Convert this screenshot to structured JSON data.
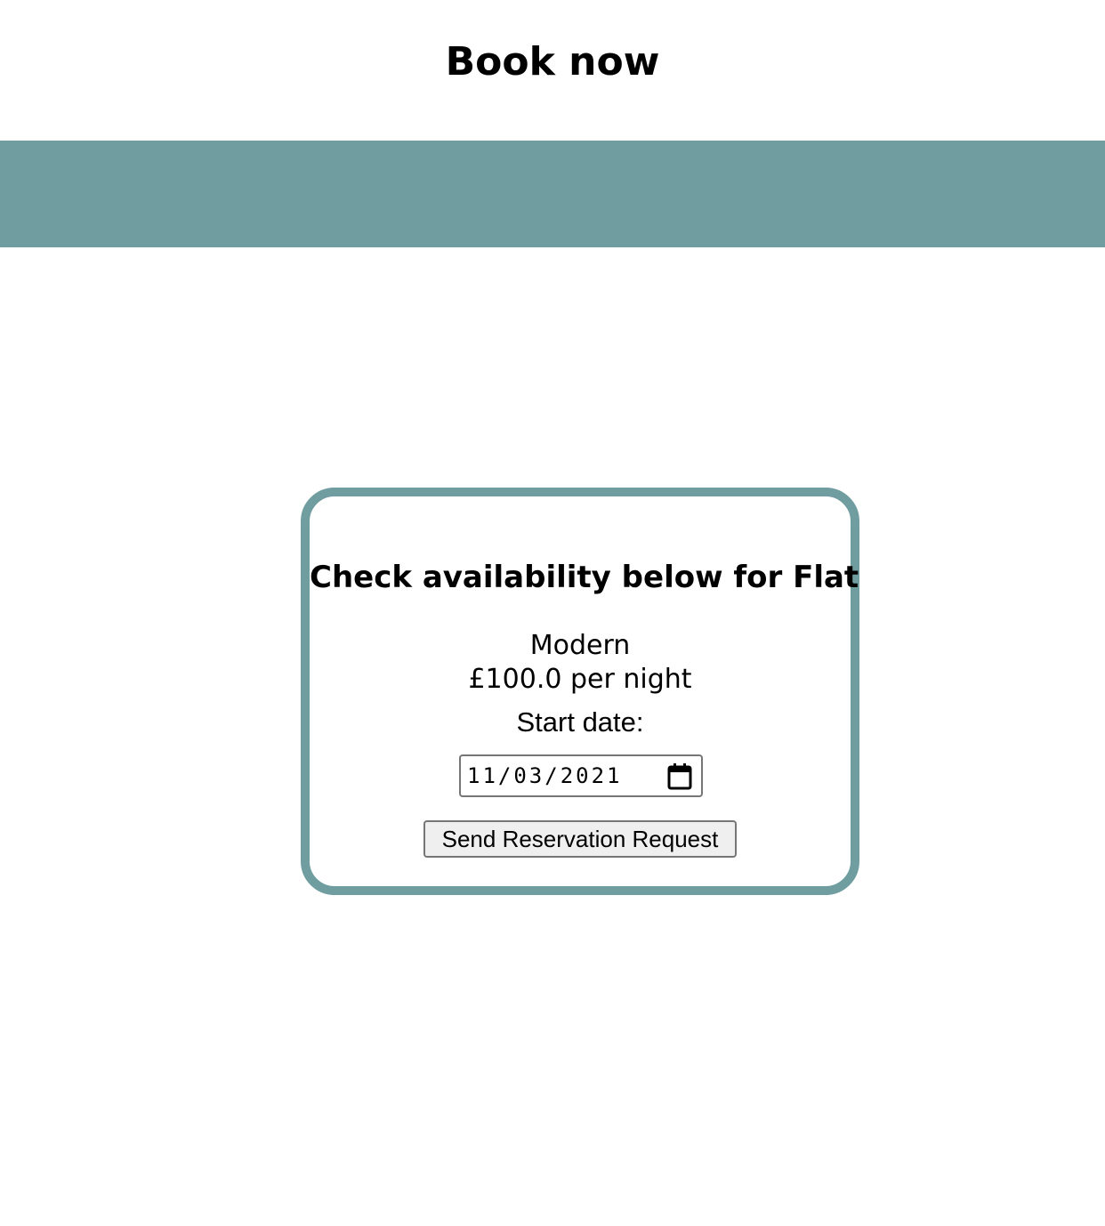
{
  "header": {
    "title": "Book now"
  },
  "colors": {
    "accent": "#709d9f"
  },
  "booking": {
    "heading": "Check availability below for Flat",
    "property_name": "Modern",
    "price": "£100.0 per night",
    "start_date_label": "Start date:",
    "start_date_value": "11/03/2021",
    "calendar_icon": "calendar-icon",
    "submit_label": "Send Reservation Request"
  }
}
